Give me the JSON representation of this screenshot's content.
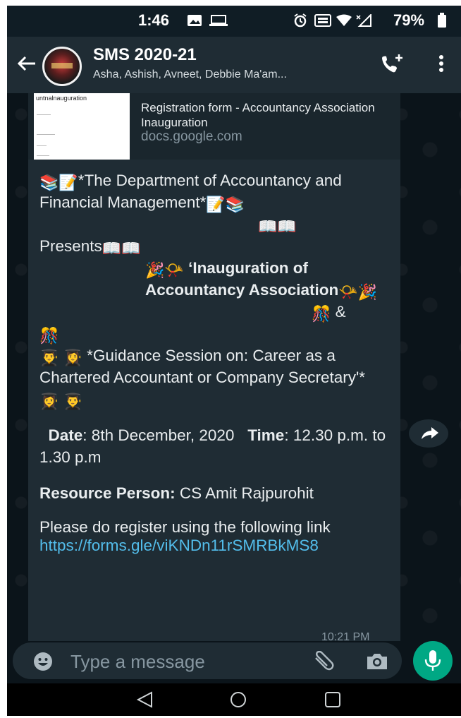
{
  "status_bar": {
    "time": "1:46",
    "battery": "79%"
  },
  "app_bar": {
    "title": "SMS 2020-21",
    "subtitle": "Asha, Ashish, Avneet, Debbie Ma'am..."
  },
  "link_preview": {
    "thumb_text": "untnalnauguration",
    "title": "Registration form - Accountancy Association Inauguration",
    "domain": "docs.google.com"
  },
  "message": {
    "line_dept": "*The Department of Accountancy and Financial Management*",
    "line_presents": "Presents",
    "line_inauguration": "‘Inauguration of Accountancy Association",
    "ampersand": "&",
    "line_guidance": "*Guidance Session on: Career as a Chartered Accountant or Company Secretary'*",
    "date_label": "Date",
    "date_value": ": 8th December, 2020",
    "time_label": "Time",
    "time_value": ": 12.30 p.m. to 1.30 p.m",
    "resource_label": "Resource Person:",
    "resource_value": " CS Amit Rajpurohit",
    "register_text": "Please do register using the following link ",
    "register_link": "https://forms.gle/viKNDn11rSMRBkMS8",
    "timestamp": "10:21 PM"
  },
  "input_bar": {
    "placeholder": "Type a message"
  },
  "colors": {
    "accent": "#00a884",
    "link": "#53bdeb",
    "bubble": "#1f2c34",
    "header": "#1f2c34"
  },
  "icons": [
    "back-arrow-icon",
    "add-call-icon",
    "more-options-icon",
    "forward-icon",
    "scroll-down-icon",
    "emoji-icon",
    "attach-icon",
    "camera-icon",
    "mic-icon"
  ]
}
